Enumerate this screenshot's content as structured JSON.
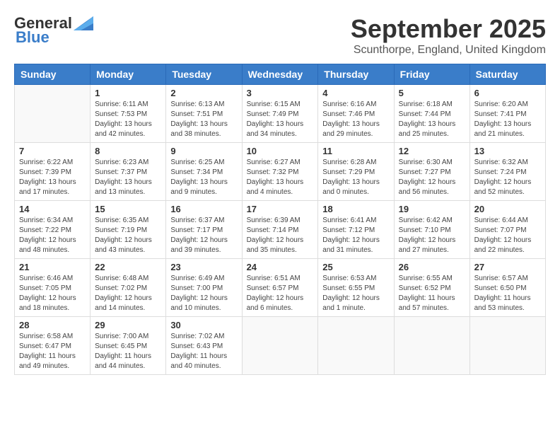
{
  "logo": {
    "general": "General",
    "blue": "Blue"
  },
  "title": "September 2025",
  "location": "Scunthorpe, England, United Kingdom",
  "days_of_week": [
    "Sunday",
    "Monday",
    "Tuesday",
    "Wednesday",
    "Thursday",
    "Friday",
    "Saturday"
  ],
  "weeks": [
    [
      {
        "day": "",
        "info": ""
      },
      {
        "day": "1",
        "info": "Sunrise: 6:11 AM\nSunset: 7:53 PM\nDaylight: 13 hours\nand 42 minutes."
      },
      {
        "day": "2",
        "info": "Sunrise: 6:13 AM\nSunset: 7:51 PM\nDaylight: 13 hours\nand 38 minutes."
      },
      {
        "day": "3",
        "info": "Sunrise: 6:15 AM\nSunset: 7:49 PM\nDaylight: 13 hours\nand 34 minutes."
      },
      {
        "day": "4",
        "info": "Sunrise: 6:16 AM\nSunset: 7:46 PM\nDaylight: 13 hours\nand 29 minutes."
      },
      {
        "day": "5",
        "info": "Sunrise: 6:18 AM\nSunset: 7:44 PM\nDaylight: 13 hours\nand 25 minutes."
      },
      {
        "day": "6",
        "info": "Sunrise: 6:20 AM\nSunset: 7:41 PM\nDaylight: 13 hours\nand 21 minutes."
      }
    ],
    [
      {
        "day": "7",
        "info": "Sunrise: 6:22 AM\nSunset: 7:39 PM\nDaylight: 13 hours\nand 17 minutes."
      },
      {
        "day": "8",
        "info": "Sunrise: 6:23 AM\nSunset: 7:37 PM\nDaylight: 13 hours\nand 13 minutes."
      },
      {
        "day": "9",
        "info": "Sunrise: 6:25 AM\nSunset: 7:34 PM\nDaylight: 13 hours\nand 9 minutes."
      },
      {
        "day": "10",
        "info": "Sunrise: 6:27 AM\nSunset: 7:32 PM\nDaylight: 13 hours\nand 4 minutes."
      },
      {
        "day": "11",
        "info": "Sunrise: 6:28 AM\nSunset: 7:29 PM\nDaylight: 13 hours\nand 0 minutes."
      },
      {
        "day": "12",
        "info": "Sunrise: 6:30 AM\nSunset: 7:27 PM\nDaylight: 12 hours\nand 56 minutes."
      },
      {
        "day": "13",
        "info": "Sunrise: 6:32 AM\nSunset: 7:24 PM\nDaylight: 12 hours\nand 52 minutes."
      }
    ],
    [
      {
        "day": "14",
        "info": "Sunrise: 6:34 AM\nSunset: 7:22 PM\nDaylight: 12 hours\nand 48 minutes."
      },
      {
        "day": "15",
        "info": "Sunrise: 6:35 AM\nSunset: 7:19 PM\nDaylight: 12 hours\nand 43 minutes."
      },
      {
        "day": "16",
        "info": "Sunrise: 6:37 AM\nSunset: 7:17 PM\nDaylight: 12 hours\nand 39 minutes."
      },
      {
        "day": "17",
        "info": "Sunrise: 6:39 AM\nSunset: 7:14 PM\nDaylight: 12 hours\nand 35 minutes."
      },
      {
        "day": "18",
        "info": "Sunrise: 6:41 AM\nSunset: 7:12 PM\nDaylight: 12 hours\nand 31 minutes."
      },
      {
        "day": "19",
        "info": "Sunrise: 6:42 AM\nSunset: 7:10 PM\nDaylight: 12 hours\nand 27 minutes."
      },
      {
        "day": "20",
        "info": "Sunrise: 6:44 AM\nSunset: 7:07 PM\nDaylight: 12 hours\nand 22 minutes."
      }
    ],
    [
      {
        "day": "21",
        "info": "Sunrise: 6:46 AM\nSunset: 7:05 PM\nDaylight: 12 hours\nand 18 minutes."
      },
      {
        "day": "22",
        "info": "Sunrise: 6:48 AM\nSunset: 7:02 PM\nDaylight: 12 hours\nand 14 minutes."
      },
      {
        "day": "23",
        "info": "Sunrise: 6:49 AM\nSunset: 7:00 PM\nDaylight: 12 hours\nand 10 minutes."
      },
      {
        "day": "24",
        "info": "Sunrise: 6:51 AM\nSunset: 6:57 PM\nDaylight: 12 hours\nand 6 minutes."
      },
      {
        "day": "25",
        "info": "Sunrise: 6:53 AM\nSunset: 6:55 PM\nDaylight: 12 hours\nand 1 minute."
      },
      {
        "day": "26",
        "info": "Sunrise: 6:55 AM\nSunset: 6:52 PM\nDaylight: 11 hours\nand 57 minutes."
      },
      {
        "day": "27",
        "info": "Sunrise: 6:57 AM\nSunset: 6:50 PM\nDaylight: 11 hours\nand 53 minutes."
      }
    ],
    [
      {
        "day": "28",
        "info": "Sunrise: 6:58 AM\nSunset: 6:47 PM\nDaylight: 11 hours\nand 49 minutes."
      },
      {
        "day": "29",
        "info": "Sunrise: 7:00 AM\nSunset: 6:45 PM\nDaylight: 11 hours\nand 44 minutes."
      },
      {
        "day": "30",
        "info": "Sunrise: 7:02 AM\nSunset: 6:43 PM\nDaylight: 11 hours\nand 40 minutes."
      },
      {
        "day": "",
        "info": ""
      },
      {
        "day": "",
        "info": ""
      },
      {
        "day": "",
        "info": ""
      },
      {
        "day": "",
        "info": ""
      }
    ]
  ]
}
